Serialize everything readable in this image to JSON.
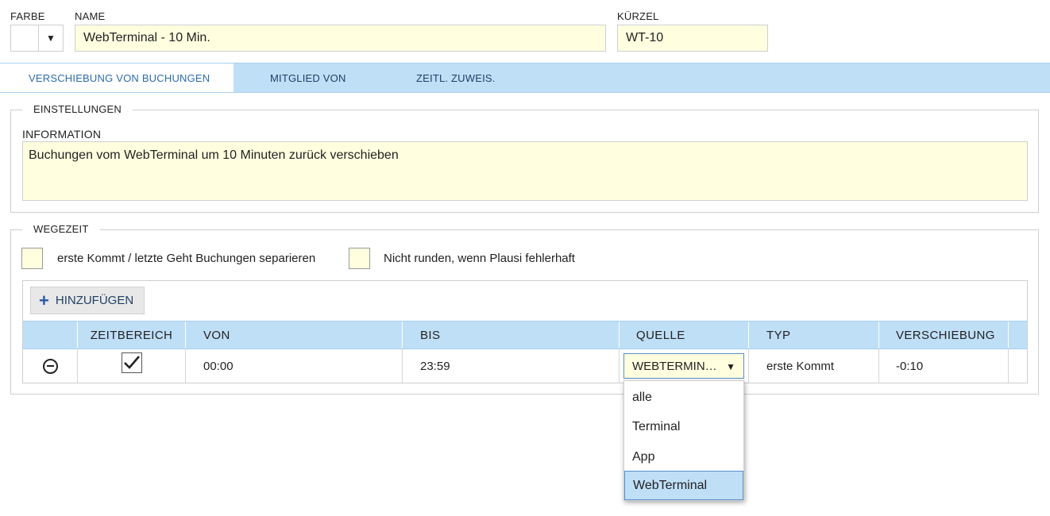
{
  "header": {
    "farbe_label": "FARBE",
    "name_label": "NAME",
    "name_value": "WebTerminal  - 10 Min.",
    "kuerzel_label": "KÜRZEL",
    "kuerzel_value": "WT-10",
    "color_arrow": "▼"
  },
  "tabs": [
    {
      "label": "VERSCHIEBUNG VON BUCHUNGEN",
      "active": true
    },
    {
      "label": "MITGLIED VON",
      "active": false
    },
    {
      "label": "ZEITL. ZUWEIS.",
      "active": false
    }
  ],
  "einstellungen": {
    "legend": "EINSTELLUNGEN",
    "info_label": "INFORMATION",
    "info_value": "Buchungen vom WebTerminal um 10 Minuten zurück verschieben"
  },
  "wegezeit": {
    "legend": "WEGEZEIT",
    "option1": "erste Kommt / letzte Geht Buchungen separieren",
    "option2": "Nicht runden, wenn Plausi fehlerhaft",
    "add_button": "HINZUFÜGEN",
    "add_icon": "+",
    "columns": [
      "ZEITBEREICH",
      "VON",
      "BIS",
      "QUELLE",
      "TYP",
      "VERSCHIEBUNG"
    ],
    "row": {
      "zeitbereich_checked": true,
      "von": "00:00",
      "bis": "23:59",
      "quelle": "WEBTERMIN…",
      "typ": "erste Kommt",
      "verschiebung": "-0:10"
    },
    "quelle_caret": "▼",
    "quelle_options": [
      "alle",
      "Terminal",
      "App",
      "WebTerminal"
    ],
    "quelle_selected": "WebTerminal"
  },
  "colors": {
    "accent_blue": "#bfdff7",
    "field_yellow": "#ffffe0",
    "active_tab_text": "#2b6cb0"
  }
}
